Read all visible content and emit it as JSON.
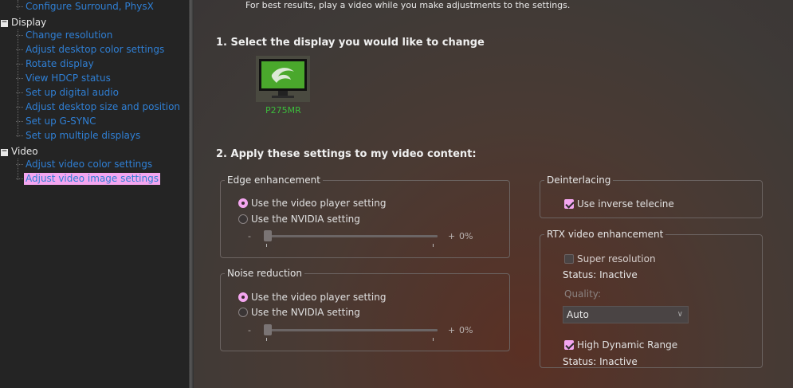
{
  "tree": {
    "top_item": "Configure Surround, PhysX",
    "categories": [
      {
        "label": "Display",
        "toggle": "−",
        "items": [
          "Change resolution",
          "Adjust desktop color settings",
          "Rotate display",
          "View HDCP status",
          "Set up digital audio",
          "Adjust desktop size and position",
          "Set up G-SYNC",
          "Set up multiple displays"
        ]
      },
      {
        "label": "Video",
        "toggle": "−",
        "items": [
          "Adjust video color settings",
          "Adjust video image settings"
        ]
      }
    ],
    "selected_item": "Adjust video image settings"
  },
  "main": {
    "hint": "For best results, play a video while you make adjustments to the settings.",
    "step1_title": "1. Select the display you would like to change",
    "display_label": "P275MR",
    "step2_title": "2. Apply these settings to my video content:",
    "edge": {
      "legend": "Edge enhancement",
      "option_player": "Use the video player setting",
      "option_nvidia": "Use the NVIDIA setting",
      "selected": "player",
      "slider_minus": "-",
      "slider_plus": "+",
      "slider_value": "0%",
      "slider_level": 0
    },
    "noise": {
      "legend": "Noise reduction",
      "option_player": "Use the video player setting",
      "option_nvidia": "Use the NVIDIA setting",
      "selected": "player",
      "slider_minus": "-",
      "slider_plus": "+",
      "slider_value": "0%",
      "slider_level": 0
    },
    "deinterlacing": {
      "legend": "Deinterlacing",
      "inverse_telecine_label": "Use inverse telecine",
      "inverse_telecine_checked": true
    },
    "rtx": {
      "legend": "RTX video enhancement",
      "super_resolution_label": "Super resolution",
      "super_resolution_checked": false,
      "super_resolution_status": "Status: Inactive",
      "quality_label": "Quality:",
      "quality_value": "Auto",
      "hdr_label": "High Dynamic Range",
      "hdr_checked": true,
      "hdr_status": "Status: Inactive"
    }
  },
  "colors": {
    "accent": "#f4a6f0",
    "link": "#2f7fd4",
    "nvidia_green": "#3cbc3c"
  }
}
